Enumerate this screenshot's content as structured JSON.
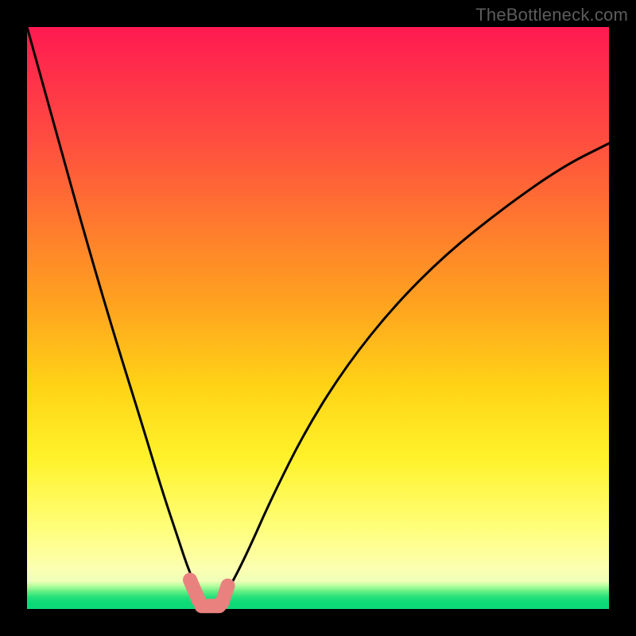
{
  "watermark": "TheBottleneck.com",
  "chart_data": {
    "type": "line",
    "title": "",
    "xlabel": "",
    "ylabel": "",
    "xlim": [
      0,
      100
    ],
    "ylim": [
      0,
      100
    ],
    "grid": false,
    "legend": false,
    "series": [
      {
        "name": "bottleneck-curve",
        "x": [
          0,
          5,
          10,
          15,
          20,
          23,
          26,
          28,
          30,
          31,
          32,
          33,
          35,
          38,
          42,
          48,
          55,
          63,
          72,
          82,
          92,
          100
        ],
        "values": [
          100,
          82,
          64,
          47,
          31,
          21,
          12,
          6,
          2,
          0,
          0,
          1,
          4,
          10,
          19,
          31,
          42,
          52,
          61,
          69,
          76,
          80
        ]
      }
    ],
    "markers": [
      {
        "name": "left-pink-marker-top",
        "x": 28.0,
        "y": 5.0
      },
      {
        "name": "left-pink-marker-bottom",
        "x": 29.5,
        "y": 1.5
      },
      {
        "name": "right-pink-marker-top",
        "x": 34.5,
        "y": 4.0
      },
      {
        "name": "right-pink-marker-bottom",
        "x": 33.5,
        "y": 1.0
      },
      {
        "name": "valley-left",
        "x": 30.0,
        "y": 0.5
      },
      {
        "name": "valley-right",
        "x": 33.0,
        "y": 0.5
      }
    ],
    "gradient_stops": [
      {
        "pct": 0,
        "color": "#ff1a52"
      },
      {
        "pct": 20,
        "color": "#ff4f3f"
      },
      {
        "pct": 48,
        "color": "#ffa41f"
      },
      {
        "pct": 74,
        "color": "#fff22a"
      },
      {
        "pct": 95,
        "color": "#f0ffb8"
      },
      {
        "pct": 100,
        "color": "#0cd977"
      }
    ]
  }
}
